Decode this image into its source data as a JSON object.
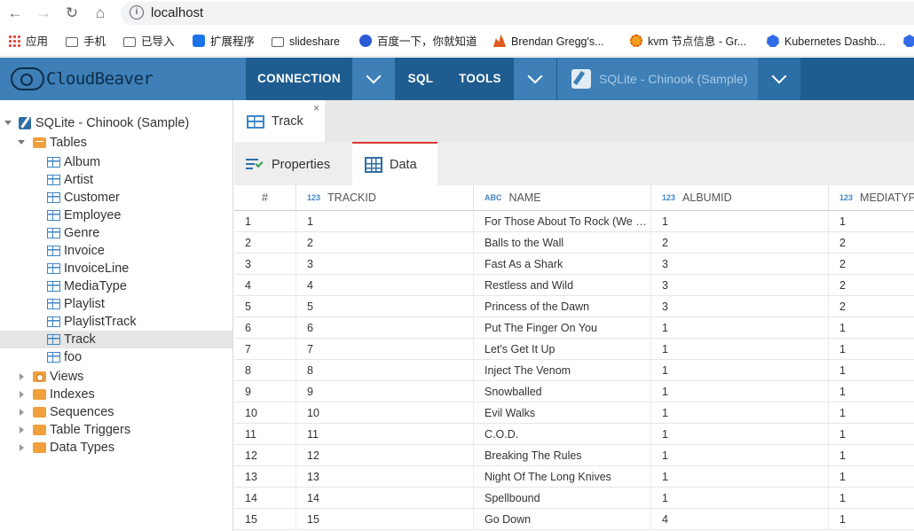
{
  "browser": {
    "url": "localhost",
    "bookmarks": [
      {
        "label": "应用",
        "icon": "apps-icon"
      },
      {
        "label": "手机",
        "icon": "folder-icon"
      },
      {
        "label": "已导入",
        "icon": "folder-icon"
      },
      {
        "label": "扩展程序",
        "icon": "puzzle-icon"
      },
      {
        "label": "slideshare",
        "icon": "folder-icon"
      },
      {
        "label": "百度一下，你就知道",
        "icon": "baidu-paw-icon"
      },
      {
        "label": "Brendan Gregg's...",
        "icon": "flame-icon"
      },
      {
        "label": "kvm 节点信息 - Gr...",
        "icon": "grafana-icon"
      },
      {
        "label": "Kubernetes Dashb...",
        "icon": "kubernetes-icon"
      }
    ]
  },
  "header": {
    "logo": "CloudBeaver",
    "menu": {
      "connection": "CONNECTION",
      "sql": "SQL",
      "tools": "TOOLS"
    },
    "active_connection": "SQLite - Chinook (Sample)"
  },
  "sidebar": {
    "connection": "SQLite - Chinook (Sample)",
    "tables_folder": "Tables",
    "tables": [
      "Album",
      "Artist",
      "Customer",
      "Employee",
      "Genre",
      "Invoice",
      "InvoiceLine",
      "MediaType",
      "Playlist",
      "PlaylistTrack",
      "Track",
      "foo"
    ],
    "selected_table": "Track",
    "folders": [
      "Views",
      "Indexes",
      "Sequences",
      "Table Triggers",
      "Data Types"
    ]
  },
  "editor": {
    "tab_label": "Track",
    "close_glyph": "×",
    "subtabs": {
      "properties": "Properties",
      "data": "Data"
    }
  },
  "grid": {
    "columns": [
      {
        "label": "#",
        "type": ""
      },
      {
        "label": "TRACKID",
        "type": "123"
      },
      {
        "label": "NAME",
        "type": "ABC"
      },
      {
        "label": "ALBUMID",
        "type": "123"
      },
      {
        "label": "MEDIATYP",
        "type": "123"
      }
    ],
    "rows": [
      [
        "1",
        "1",
        "For Those About To Rock (We Salute You)",
        "1",
        "1"
      ],
      [
        "2",
        "2",
        "Balls to the Wall",
        "2",
        "2"
      ],
      [
        "3",
        "3",
        "Fast As a Shark",
        "3",
        "2"
      ],
      [
        "4",
        "4",
        "Restless and Wild",
        "3",
        "2"
      ],
      [
        "5",
        "5",
        "Princess of the Dawn",
        "3",
        "2"
      ],
      [
        "6",
        "6",
        "Put The Finger On You",
        "1",
        "1"
      ],
      [
        "7",
        "7",
        "Let's Get It Up",
        "1",
        "1"
      ],
      [
        "8",
        "8",
        "Inject The Venom",
        "1",
        "1"
      ],
      [
        "9",
        "9",
        "Snowballed",
        "1",
        "1"
      ],
      [
        "10",
        "10",
        "Evil Walks",
        "1",
        "1"
      ],
      [
        "11",
        "11",
        "C.O.D.",
        "1",
        "1"
      ],
      [
        "12",
        "12",
        "Breaking The Rules",
        "1",
        "1"
      ],
      [
        "13",
        "13",
        "Night Of The Long Knives",
        "1",
        "1"
      ],
      [
        "14",
        "14",
        "Spellbound",
        "1",
        "1"
      ],
      [
        "15",
        "15",
        "Go Down",
        "4",
        "1"
      ]
    ]
  }
}
